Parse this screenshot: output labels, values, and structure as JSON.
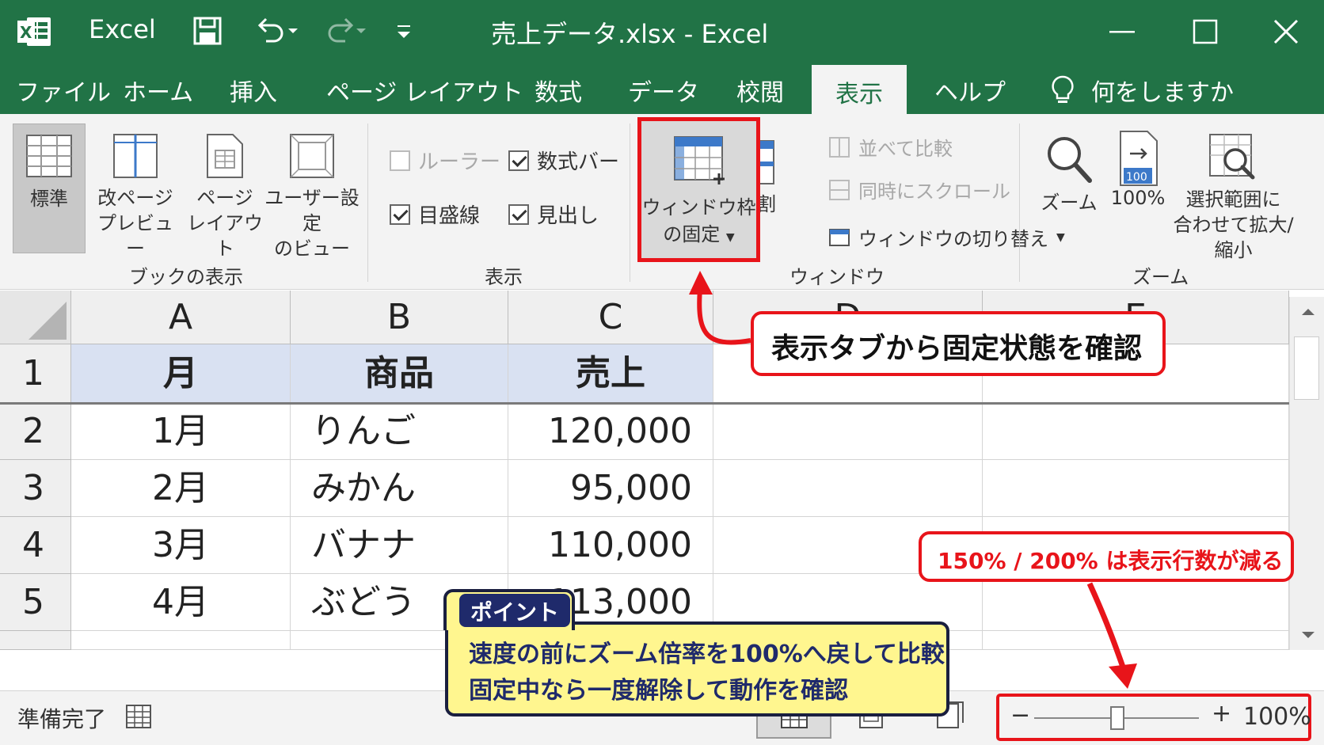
{
  "titlebar": {
    "app_name": "Excel",
    "doc_title": "売上データ.xlsx  -  Excel"
  },
  "tabs": [
    {
      "label": "ファイル"
    },
    {
      "label": "ホーム"
    },
    {
      "label": "挿入"
    },
    {
      "label": "ページ レイアウト"
    },
    {
      "label": "数式"
    },
    {
      "label": "データ"
    },
    {
      "label": "校閲"
    },
    {
      "label": "表示",
      "active": true
    },
    {
      "label": "ヘルプ"
    }
  ],
  "tell_me": "何をしますか",
  "ribbon": {
    "workbook_views": {
      "label": "ブックの表示",
      "normal": "標準",
      "page_break": [
        "改ページ",
        "プレビュー"
      ],
      "page_layout": [
        "ページ",
        "レイアウト"
      ],
      "custom_views": [
        "ユーザー設定",
        "のビュー"
      ]
    },
    "show": {
      "label": "表示",
      "ruler": "ルーラー",
      "formula_bar": "数式バー",
      "gridlines": "目盛線",
      "headings": "見出し"
    },
    "window": {
      "label": "ウィンドウ",
      "freeze_panes": [
        "ウィンドウ枠",
        "の固定"
      ],
      "split": "分割",
      "view_side_by_side": "並べて比較",
      "sync_scroll": "同時にスクロール",
      "switch_windows": "ウィンドウの切り替え"
    },
    "zoom": {
      "label": "ズーム",
      "zoom": "ズーム",
      "zoom100": "100%",
      "zoom100_badge": "100",
      "zoom_selection": [
        "選択範囲に",
        "合わせて拡大/縮小"
      ]
    }
  },
  "sheet": {
    "columns": [
      "A",
      "B",
      "C",
      "D",
      "E"
    ],
    "rows": [
      "1",
      "2",
      "3",
      "4",
      "5"
    ],
    "header": [
      "月",
      "商品",
      "売上"
    ],
    "data": [
      [
        "1月",
        "りんご",
        "120,000"
      ],
      [
        "2月",
        "みかん",
        "95,000"
      ],
      [
        "3月",
        "バナナ",
        "110,000"
      ],
      [
        "4月",
        "ぶどう",
        "113,000"
      ]
    ]
  },
  "statusbar": {
    "status": "準備完了",
    "zoom_minus": "−",
    "zoom_plus": "+",
    "zoom_percent": "100%",
    "zoom_level": 100
  },
  "annotations": {
    "callout_tab": "表示タブから固定状態を確認",
    "callout_zoom": "150% / 200% は表示行数が減る",
    "point_badge": "ポイント",
    "point_line1": "速度の前にズーム倍率を100%へ戻して比較",
    "point_line2": "固定中なら一度解除して動作を確認"
  },
  "colors": {
    "excel_green": "#217346",
    "highlight_red": "#e8141a",
    "point_yellow": "#fff68f",
    "point_navy": "#1f2a6b",
    "header_fill": "#d9e1f2"
  }
}
